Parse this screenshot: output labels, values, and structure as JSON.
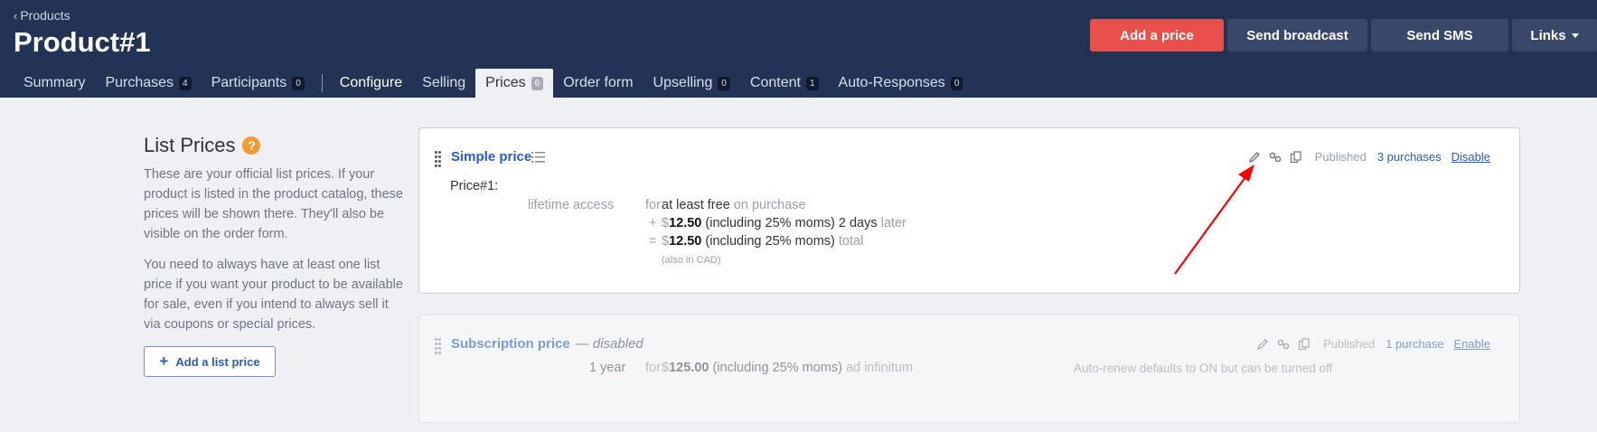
{
  "header": {
    "back_label": "Products",
    "title": "Product#1",
    "actions": {
      "add_price": "Add a price",
      "send_broadcast": "Send broadcast",
      "send_sms": "Send SMS",
      "links": "Links"
    },
    "tabs": [
      {
        "label": "Summary",
        "count": ""
      },
      {
        "label": "Purchases",
        "count": "4"
      },
      {
        "label": "Participants",
        "count": "0"
      },
      {
        "label": "Configure",
        "count": ""
      },
      {
        "label": "Selling",
        "count": ""
      },
      {
        "label": "Prices",
        "count": "6"
      },
      {
        "label": "Order form",
        "count": ""
      },
      {
        "label": "Upselling",
        "count": "0"
      },
      {
        "label": "Content",
        "count": "1"
      },
      {
        "label": "Auto-Responses",
        "count": "0"
      }
    ]
  },
  "sidebar": {
    "title": "List Prices",
    "help": "?",
    "para1": "These are your official list prices. If your product is listed in the product catalog, these prices will be shown there. They'll also be visible on the order form.",
    "para2": "You need to always have at least one list price if you want your product to be available for sale, even if you intend to always sell it via coupons or special prices.",
    "add_button": "Add a list price"
  },
  "prices": [
    {
      "title": "Simple price",
      "status": "Published",
      "purchases": "3 purchases",
      "toggle": "Disable",
      "name": "Price#1:",
      "access": "lifetime access",
      "for": "for",
      "line1_value": "at least free",
      "line1_suffix": "on purchase",
      "plus": "+",
      "currency": "$",
      "line2_amount": "12.50",
      "line2_tax": "(including 25% moms) 2 days",
      "line2_suffix": "later",
      "equals": "=",
      "line3_amount": "12.50",
      "line3_tax": "(including 25% moms)",
      "line3_suffix": "total",
      "also": "(also in CAD)"
    },
    {
      "title": "Subscription price",
      "disabled_tag": "— disabled",
      "status": "Published",
      "purchases": "1 purchase",
      "toggle": "Enable",
      "period": "1 year",
      "for": "for",
      "currency": "$",
      "amount": "125.00",
      "tax": "(including 25% moms)",
      "suffix": "ad infinitum",
      "note": "Auto-renew defaults to ON but can be turned off"
    }
  ],
  "colors": {
    "header_bg": "#223355",
    "primary": "#e9504c",
    "link": "#2b59c3",
    "annotation": "#ff0000"
  }
}
